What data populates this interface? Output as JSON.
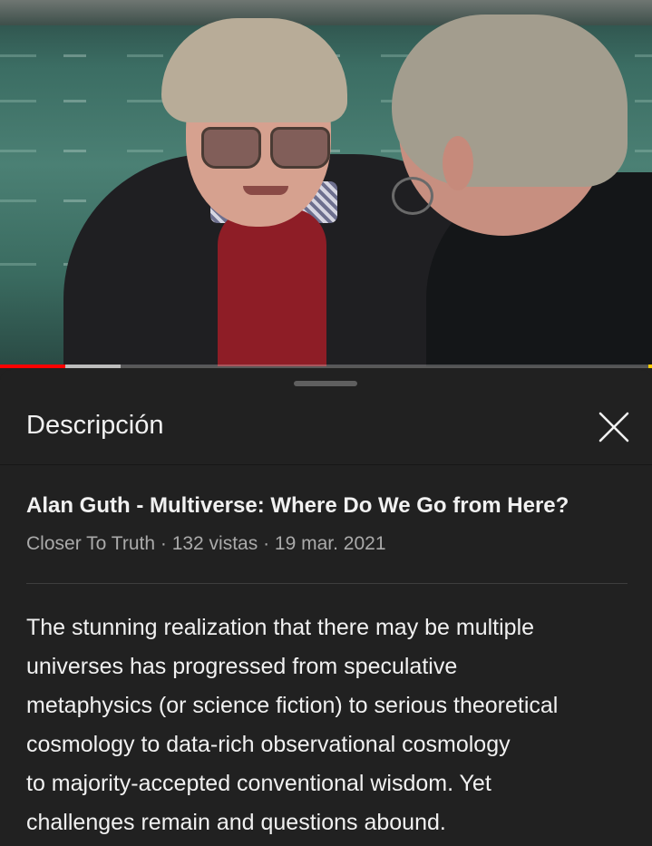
{
  "sheet": {
    "header_title": "Descripción",
    "video_title": "Alan Guth - Multiverse: Where Do We Go from Here?",
    "channel": "Closer To Truth",
    "separator": " · ",
    "views": "132 vistas",
    "date": "19 mar. 2021",
    "description_lines": [
      "The stunning realization that there may be multiple",
      "universes has progressed from speculative",
      "metaphysics (or science fiction) to serious theoretical",
      "cosmology to data-rich observational cosmology",
      "to majority-accepted conventional wisdom. Yet",
      "challenges remain and questions abound."
    ]
  },
  "player": {
    "played_fraction": 0.1,
    "buffered_fraction": 0.185,
    "colors": {
      "played": "#ff0000",
      "buffer": "#bdbdbd",
      "end_marker": "#ffcc00"
    }
  },
  "icons": {
    "close": "close-icon"
  },
  "colors": {
    "background": "#212121",
    "text": "#f1f1f1",
    "secondary_text": "#aaaaaa"
  }
}
